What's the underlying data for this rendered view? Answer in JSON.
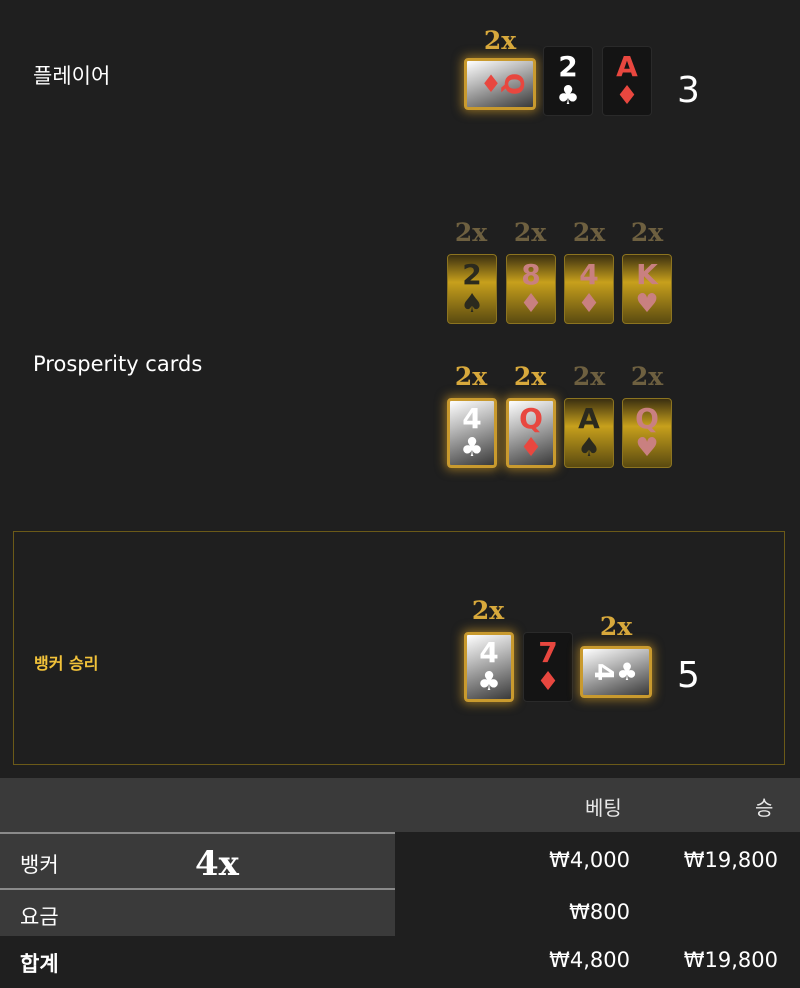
{
  "player": {
    "label": "플레이어",
    "score": "3",
    "multiplier": "2x",
    "cards": [
      {
        "rank": "Q",
        "suit": "♦",
        "style": "gold-sideways"
      },
      {
        "rank": "2",
        "suit": "♣",
        "style": "plain"
      },
      {
        "rank": "A",
        "suit": "♦",
        "style": "plain"
      }
    ]
  },
  "prosperity": {
    "label": "Prosperity cards",
    "row1": [
      {
        "mult": "2x",
        "rank": "2",
        "suit": "♠"
      },
      {
        "mult": "2x",
        "rank": "8",
        "suit": "♦"
      },
      {
        "mult": "2x",
        "rank": "4",
        "suit": "♦"
      },
      {
        "mult": "2x",
        "rank": "K",
        "suit": "♥"
      }
    ],
    "row2": [
      {
        "mult": "2x",
        "rank": "4",
        "suit": "♣",
        "active": true
      },
      {
        "mult": "2x",
        "rank": "Q",
        "suit": "♦",
        "active": true
      },
      {
        "mult": "2x",
        "rank": "A",
        "suit": "♠",
        "active": false
      },
      {
        "mult": "2x",
        "rank": "Q",
        "suit": "♥",
        "active": false
      }
    ]
  },
  "banker": {
    "label": "뱅커 승리",
    "score": "5",
    "cards": [
      {
        "mult": "2x",
        "rank": "4",
        "suit": "♣",
        "style": "gold"
      },
      {
        "rank": "7",
        "suit": "♦",
        "style": "plain"
      },
      {
        "mult": "2x",
        "rank": "4",
        "suit": "♣",
        "style": "gold-sideways"
      }
    ]
  },
  "table": {
    "col_bet": "베팅",
    "col_win": "승",
    "rows": [
      {
        "label": "뱅커",
        "badge": "4x",
        "bet": "₩4,000",
        "win": "₩19,800"
      },
      {
        "label": "요금",
        "bet": "₩800",
        "win": ""
      },
      {
        "label": "합계",
        "bet": "₩4,800",
        "win": "₩19,800"
      }
    ]
  },
  "colors": {
    "gold": "#d8a93c",
    "win_label": "#f2c23a",
    "red_suit": "#e8473f"
  }
}
